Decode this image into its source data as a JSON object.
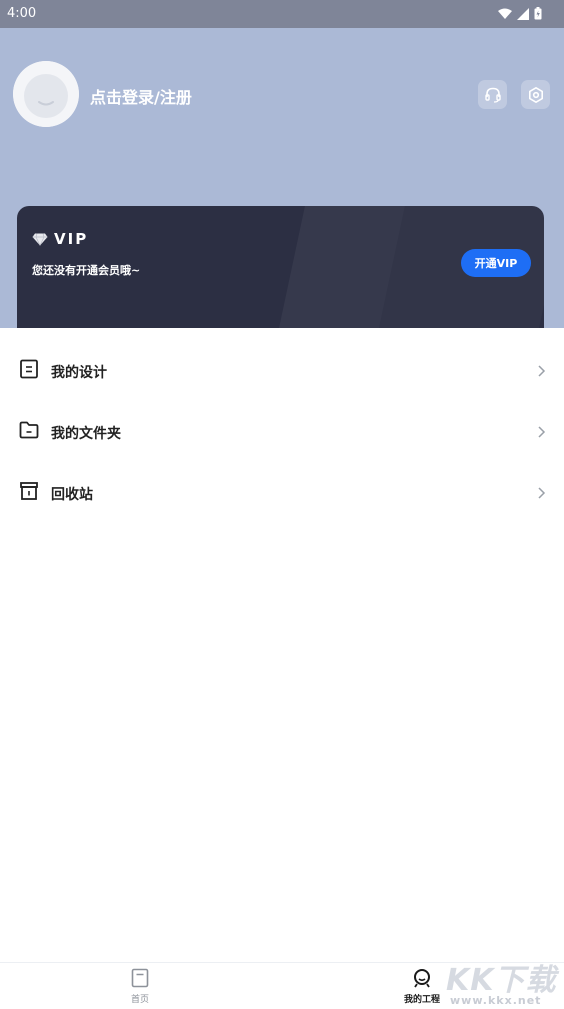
{
  "status_bar": {
    "time": "4:00"
  },
  "header": {
    "login_text": "点击登录/注册",
    "support_icon": "headset-icon",
    "settings_icon": "settings-icon"
  },
  "vip": {
    "title": "VIP",
    "subtitle": "您还没有开通会员哦~",
    "button_label": "开通VIP",
    "accent_color": "#1e6ef5"
  },
  "menu": {
    "items": [
      {
        "label": "我的设计",
        "icon": "document-icon"
      },
      {
        "label": "我的文件夹",
        "icon": "folder-icon"
      },
      {
        "label": "回收站",
        "icon": "trash-icon"
      }
    ]
  },
  "bottom_nav": {
    "items": [
      {
        "label": "首页",
        "icon": "home-icon",
        "active": false
      },
      {
        "label": "我的工程",
        "icon": "profile-icon",
        "active": true
      }
    ]
  },
  "watermark": {
    "brand": "KK下载",
    "url": "www.kkx.net"
  }
}
